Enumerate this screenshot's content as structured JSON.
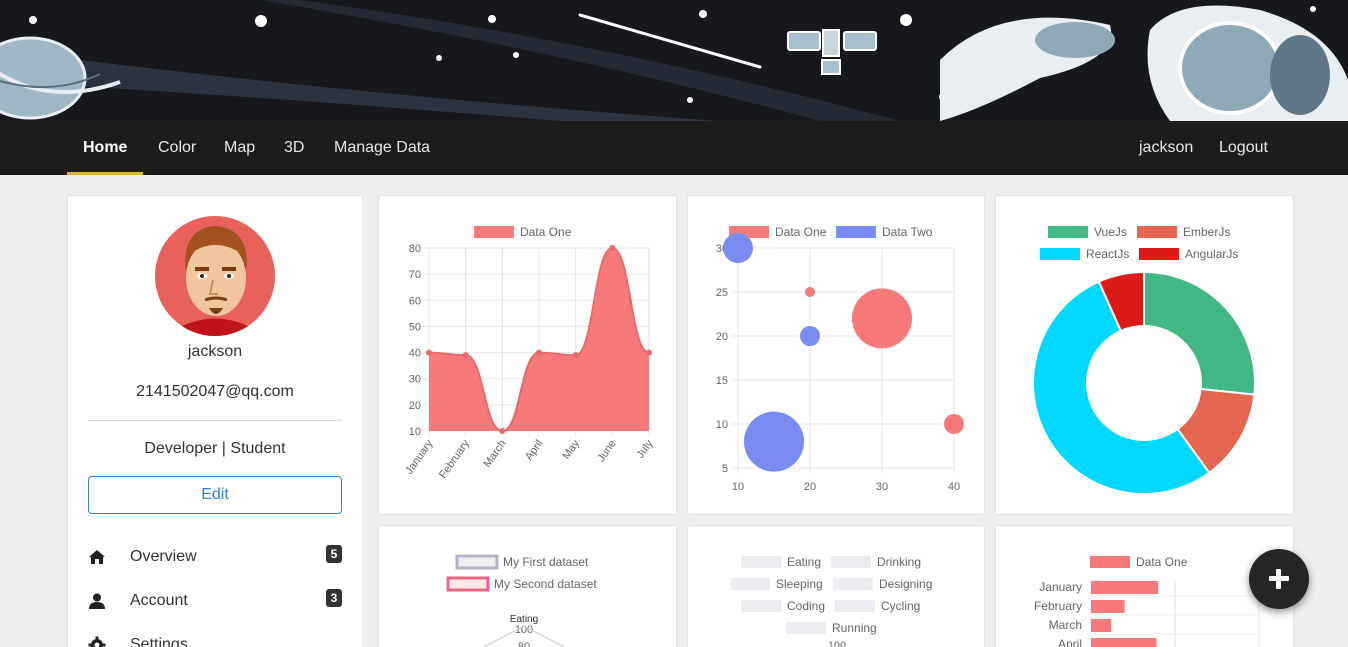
{
  "nav": {
    "left": [
      {
        "label": "Home",
        "active": true
      },
      {
        "label": "Color"
      },
      {
        "label": "Map"
      },
      {
        "label": "3D"
      },
      {
        "label": "Manage Data"
      }
    ],
    "user": "jackson",
    "logout": "Logout"
  },
  "profile": {
    "name": "jackson",
    "email": "2141502047@qq.com",
    "role": "Developer | Student",
    "edit_label": "Edit",
    "menu": [
      {
        "label": "Overview",
        "icon": "home-icon",
        "badge": "5"
      },
      {
        "label": "Account",
        "icon": "user-icon",
        "badge": "3"
      },
      {
        "label": "Settings",
        "icon": "gear-icon",
        "badge": ""
      }
    ]
  },
  "colors": {
    "red": "#f87979",
    "blue": "#7a8cf2",
    "vue": "#41b883",
    "ember": "#e46651",
    "react": "#00d8ff",
    "angular": "#dd1b16",
    "fab": "#262626",
    "nav_accent": "#e0b040",
    "edit_blue": "#2f7fd6"
  },
  "fab": {
    "icon": "plus-icon"
  },
  "chart_data": [
    {
      "type": "area",
      "series": [
        {
          "name": "Data One",
          "values": [
            40,
            39,
            10,
            40,
            39,
            80,
            40
          ]
        }
      ],
      "categories": [
        "January",
        "February",
        "March",
        "April",
        "May",
        "June",
        "July"
      ],
      "yticks": [
        "10",
        "20",
        "30",
        "40",
        "50",
        "60",
        "70",
        "80"
      ],
      "ylim": [
        10,
        80
      ]
    },
    {
      "type": "scatter",
      "series": [
        {
          "name": "Data One",
          "points": [
            {
              "x": 20,
              "y": 25,
              "r": 5
            },
            {
              "x": 30,
              "y": 22,
              "r": 30
            },
            {
              "x": 40,
              "y": 10,
              "r": 10
            }
          ]
        },
        {
          "name": "Data Two",
          "points": [
            {
              "x": 10,
              "y": 30,
              "r": 15
            },
            {
              "x": 20,
              "y": 20,
              "r": 10
            },
            {
              "x": 15,
              "y": 8,
              "r": 30
            }
          ]
        }
      ],
      "xticks": [
        "10",
        "20",
        "30",
        "40"
      ],
      "yticks": [
        "5",
        "10",
        "15",
        "20",
        "25",
        "30"
      ],
      "xlim": [
        10,
        40
      ],
      "ylim": [
        5,
        30
      ]
    },
    {
      "type": "pie",
      "labels": [
        "VueJs",
        "EmberJs",
        "ReactJs",
        "AngularJs"
      ],
      "values": [
        40,
        20,
        80,
        10
      ]
    },
    {
      "type": "radar",
      "series": [
        {
          "name": "My First dataset"
        },
        {
          "name": "My Second dataset"
        }
      ],
      "labels": [
        "Eating"
      ],
      "ticks": [
        "100",
        "80"
      ]
    },
    {
      "type": "radar",
      "legend": [
        "Eating",
        "Drinking",
        "Sleeping",
        "Designing",
        "Coding",
        "Cycling",
        "Running"
      ],
      "ticks": [
        "100"
      ]
    },
    {
      "type": "bar",
      "orientation": "horizontal",
      "series": [
        {
          "name": "Data One",
          "values": [
            40,
            20,
            12,
            39
          ]
        }
      ],
      "categories": [
        "January",
        "February",
        "March",
        "April"
      ]
    }
  ]
}
